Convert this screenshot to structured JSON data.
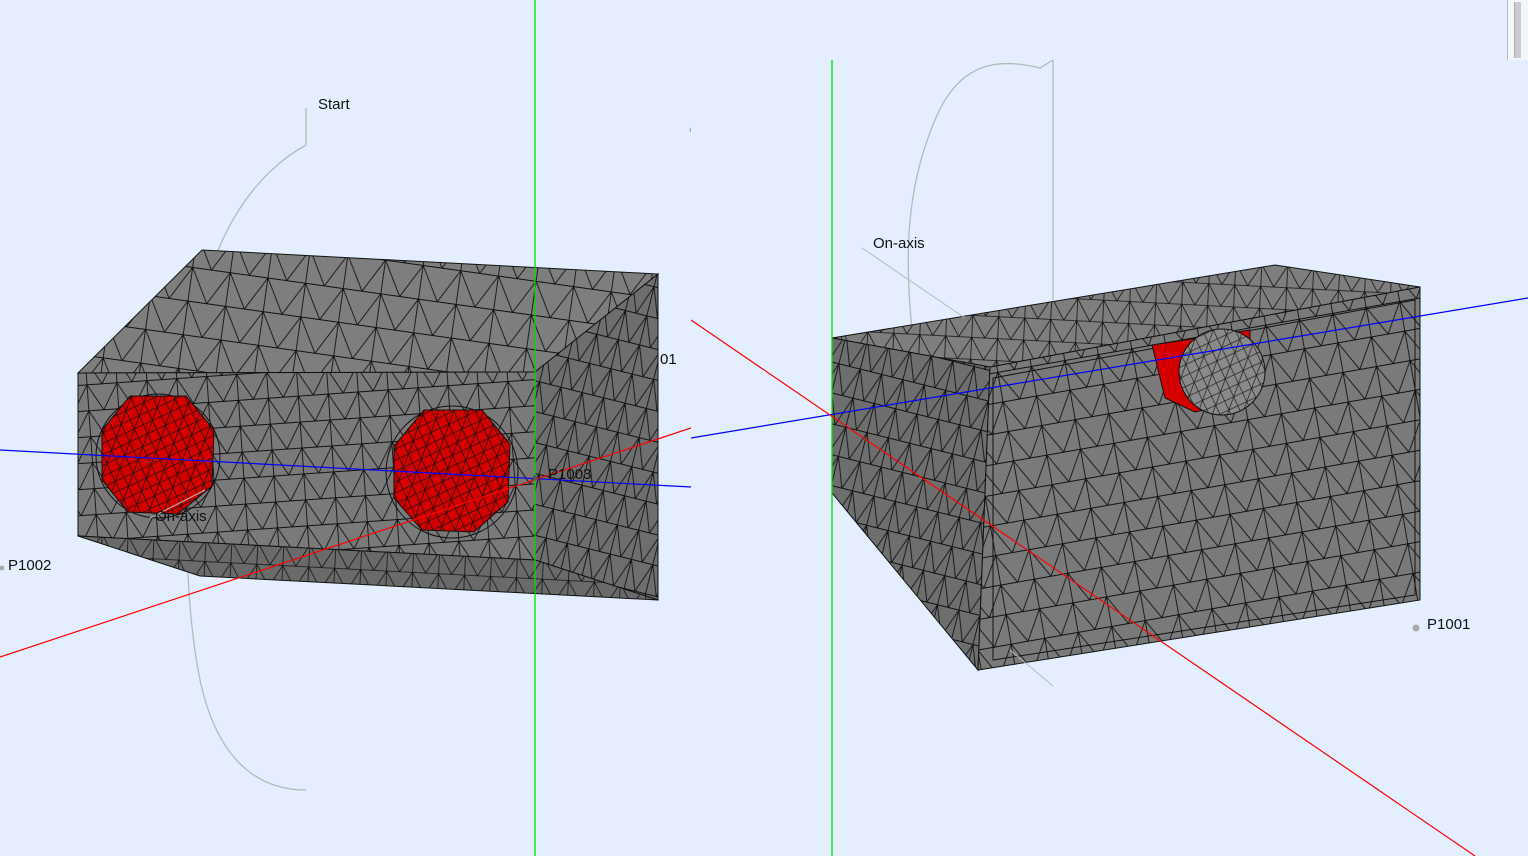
{
  "viewports": {
    "left": {
      "labels": {
        "start": "Start",
        "p1002_top": "P1002",
        "p1001_partial": "01",
        "p1003": "P1003",
        "on_axis": "On-axis",
        "p1002_left": "P1002"
      }
    },
    "right": {
      "labels": {
        "on_axis": "On-axis",
        "p1001": "P1001"
      }
    }
  },
  "colors": {
    "background": "#e3efff",
    "mesh_face": "#7a7a7a",
    "mesh_face_light": "#8c8c8c",
    "mesh_face_dark": "#6a6a6a",
    "mesh_edge": "#111111",
    "hole_fill": "#d40000",
    "axis_x": "#ff0000",
    "axis_y": "#00dd00",
    "axis_z": "#0000ff",
    "guide_line": "#b8b8b8"
  }
}
